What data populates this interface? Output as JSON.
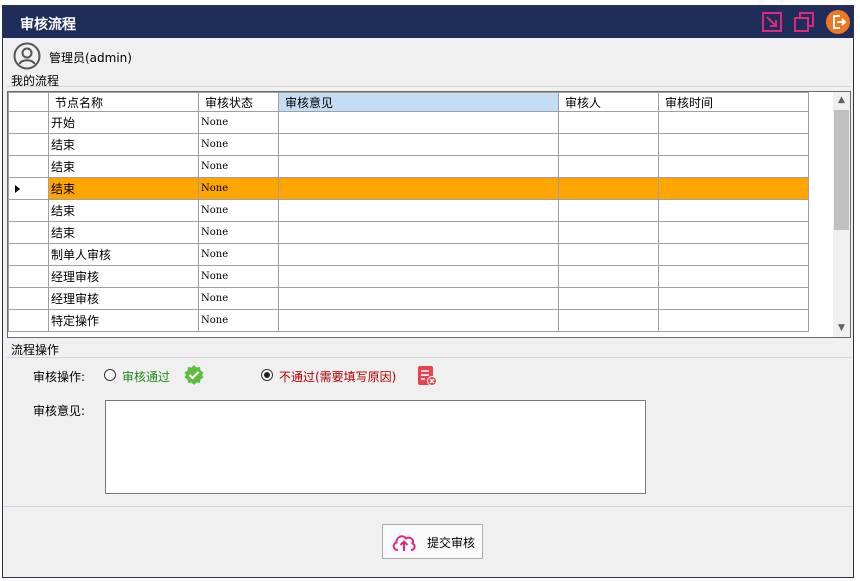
{
  "window": {
    "title": "审核流程"
  },
  "user": {
    "name": "管理员(admin)"
  },
  "flow": {
    "label": "我的流程",
    "columns": [
      "节点名称",
      "审核状态",
      "审核意见",
      "审核人",
      "审核时间"
    ],
    "rows": [
      {
        "node": "开始",
        "status": "None",
        "opinion": "",
        "reviewer": "",
        "time": ""
      },
      {
        "node": "结束",
        "status": "None",
        "opinion": "",
        "reviewer": "",
        "time": ""
      },
      {
        "node": "结束",
        "status": "None",
        "opinion": "",
        "reviewer": "",
        "time": ""
      },
      {
        "node": "结束",
        "status": "None",
        "opinion": "",
        "reviewer": "",
        "time": ""
      },
      {
        "node": "结束",
        "status": "None",
        "opinion": "",
        "reviewer": "",
        "time": ""
      },
      {
        "node": "结束",
        "status": "None",
        "opinion": "",
        "reviewer": "",
        "time": ""
      },
      {
        "node": "制单人审核",
        "status": "None",
        "opinion": "",
        "reviewer": "",
        "time": ""
      },
      {
        "node": "经理审核",
        "status": "None",
        "opinion": "",
        "reviewer": "",
        "time": ""
      },
      {
        "node": "经理审核",
        "status": "None",
        "opinion": "",
        "reviewer": "",
        "time": ""
      },
      {
        "node": "特定操作",
        "status": "None",
        "opinion": "",
        "reviewer": "",
        "time": ""
      }
    ],
    "current_row_index": 3,
    "highlight_color": "#ffa500"
  },
  "ops": {
    "label": "流程操作",
    "op_label": "审核操作:",
    "pass_label": "审核通过",
    "reject_label": "不通过(需要填写原因)",
    "selected": "reject",
    "opinion_label": "审核意见:",
    "opinion_value": "",
    "submit_label": "提交审核"
  },
  "colors": {
    "titlebar": "#1e2d5a",
    "accent_pink": "#e0287a",
    "accent_orange": "#f07820",
    "pass_green": "#5cbf3c",
    "reject_red": "#e8424a"
  },
  "icons": {
    "restore": "restore-icon",
    "copy": "copy-window-icon",
    "exit": "exit-icon",
    "avatar": "user-avatar-icon",
    "pass": "check-badge-icon",
    "reject": "reject-doc-icon",
    "submit": "cloud-upload-icon"
  }
}
